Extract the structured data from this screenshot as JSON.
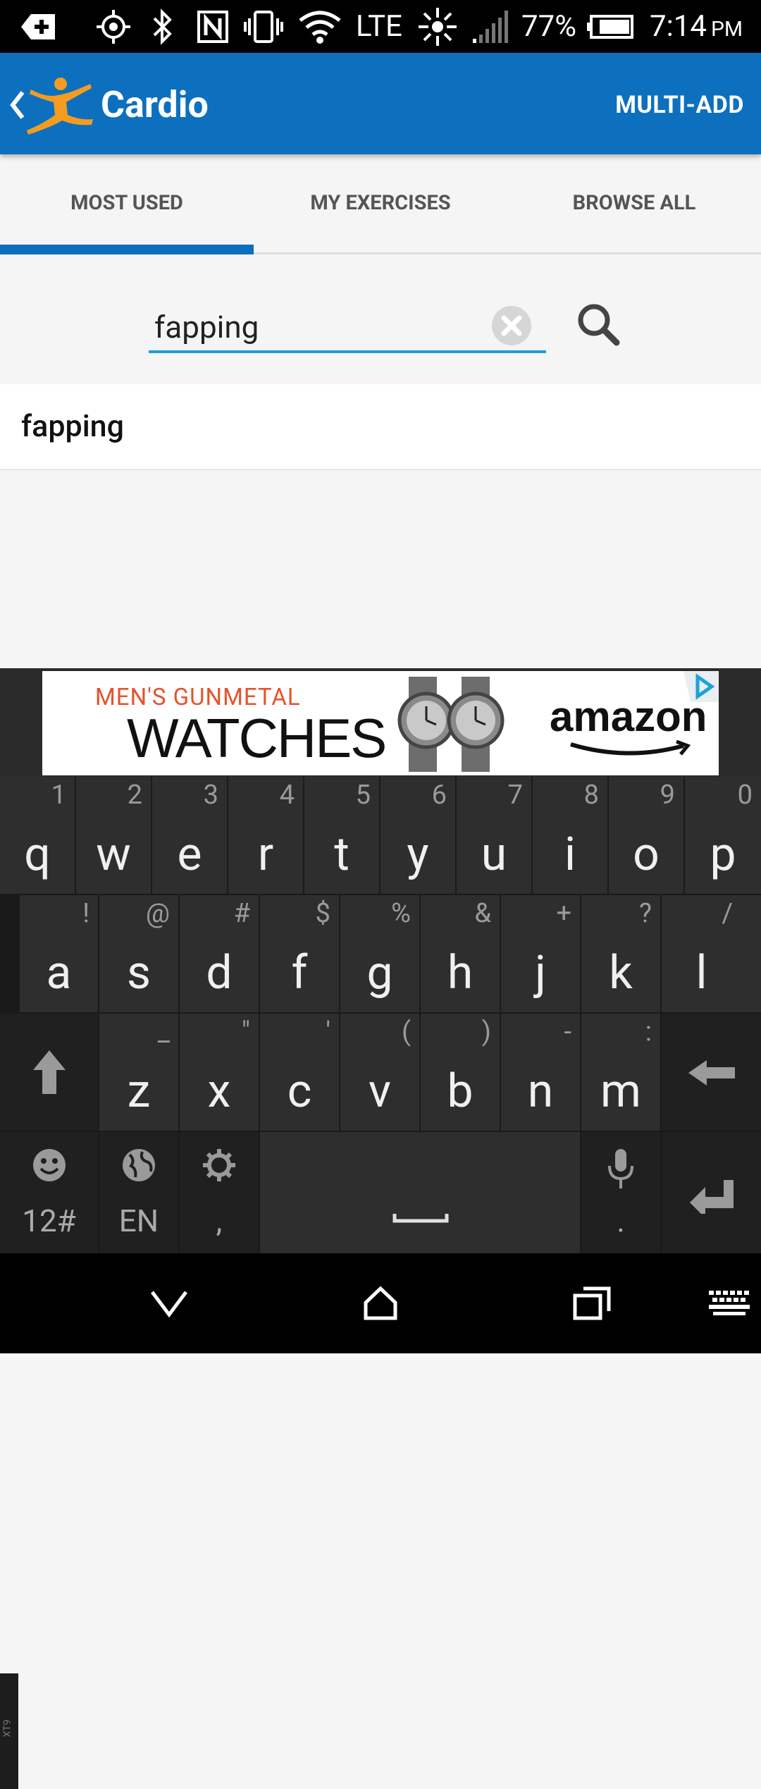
{
  "status_bar": {
    "battery_percent": "77%",
    "network": "LTE",
    "time": "7:14",
    "time_period": "PM"
  },
  "app_bar": {
    "title": "Cardio",
    "action": "MULTI-ADD"
  },
  "tabs": [
    {
      "label": "MOST USED",
      "selected": true
    },
    {
      "label": "MY EXERCISES",
      "selected": false
    },
    {
      "label": "BROWSE ALL",
      "selected": false
    }
  ],
  "search": {
    "value": "fapping",
    "placeholder": ""
  },
  "results": [
    {
      "label": "fapping"
    }
  ],
  "ad": {
    "line1": "MEN'S GUNMETAL",
    "line2": "WATCHES",
    "brand": "amazon"
  },
  "keyboard": {
    "row1": [
      {
        "key": "q",
        "hint": "1"
      },
      {
        "key": "w",
        "hint": "2"
      },
      {
        "key": "e",
        "hint": "3"
      },
      {
        "key": "r",
        "hint": "4"
      },
      {
        "key": "t",
        "hint": "5"
      },
      {
        "key": "y",
        "hint": "6"
      },
      {
        "key": "u",
        "hint": "7"
      },
      {
        "key": "i",
        "hint": "8"
      },
      {
        "key": "o",
        "hint": "9"
      },
      {
        "key": "p",
        "hint": "0"
      }
    ],
    "row2": [
      {
        "key": "a",
        "hint": "!"
      },
      {
        "key": "s",
        "hint": "@"
      },
      {
        "key": "d",
        "hint": "#"
      },
      {
        "key": "f",
        "hint": "$"
      },
      {
        "key": "g",
        "hint": "%"
      },
      {
        "key": "h",
        "hint": "&"
      },
      {
        "key": "j",
        "hint": "+"
      },
      {
        "key": "k",
        "hint": "?"
      },
      {
        "key": "l",
        "hint": "/"
      }
    ],
    "row3": [
      {
        "key": "z",
        "hint": "_"
      },
      {
        "key": "x",
        "hint": "\""
      },
      {
        "key": "c",
        "hint": "'"
      },
      {
        "key": "v",
        "hint": "("
      },
      {
        "key": "b",
        "hint": ")"
      },
      {
        "key": "n",
        "hint": "-"
      },
      {
        "key": "m",
        "hint": ":"
      }
    ],
    "side_label": "XT9",
    "symbols_label": "12#",
    "language_label": "EN",
    "comma_label": ",",
    "period_label": "."
  },
  "icons": {
    "status": [
      "add-icon",
      "gps-icon",
      "bluetooth-icon",
      "nfc-icon",
      "vibrate-icon",
      "wifi-icon",
      "sync-icon",
      "signal-icon",
      "battery-icon"
    ],
    "nav": [
      "back-icon",
      "home-icon",
      "recents-icon",
      "keyboard-icon"
    ]
  },
  "colors": {
    "app_bar": "#0d70bf",
    "tab_indicator": "#0d70bf",
    "search_underline": "#1a9fd9",
    "logo": "#f39c1f",
    "ad_accent": "#e4532b"
  }
}
